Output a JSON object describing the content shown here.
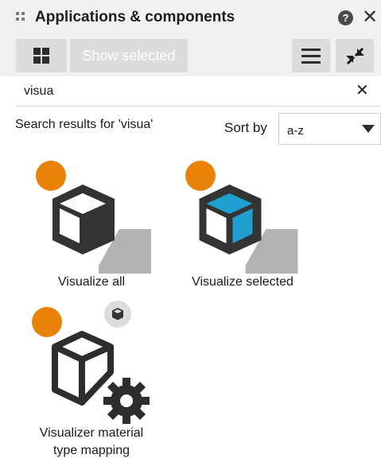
{
  "panel": {
    "title": "Applications & components"
  },
  "toolbar": {
    "show_selected_label": "Show selected"
  },
  "search": {
    "value": "visua",
    "results_text": "Search results for 'visua'"
  },
  "sort": {
    "label": "Sort by",
    "selected": "a-z"
  },
  "tiles": [
    {
      "label": "Visualize all",
      "icon": "visualize-all-icon",
      "status_color": "#e88209"
    },
    {
      "label": "Visualize selected",
      "icon": "visualize-selected-icon",
      "status_color": "#e88209",
      "accent_color": "#1e9fd0"
    },
    {
      "label_lines": [
        "Visualizer material",
        "type mapping"
      ],
      "icon": "visualizer-material-mapping-icon",
      "status_color": "#e88209",
      "badge_icon": "component-cube-icon"
    }
  ]
}
